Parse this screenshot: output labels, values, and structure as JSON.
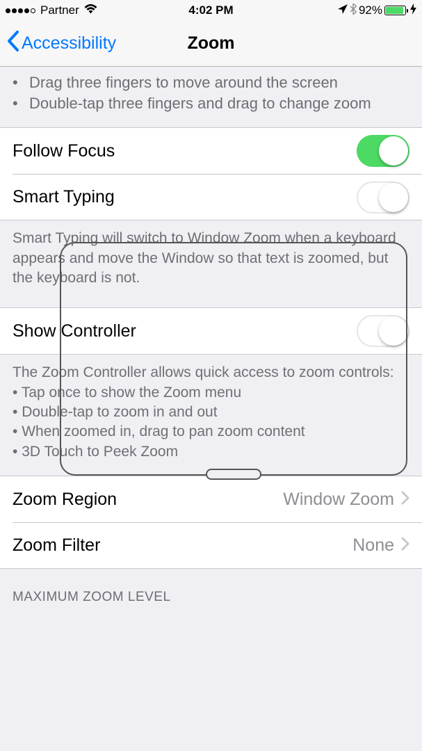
{
  "status": {
    "carrier": "Partner",
    "time": "4:02 PM",
    "battery_pct": "92%"
  },
  "nav": {
    "back_label": "Accessibility",
    "title": "Zoom"
  },
  "intro_help": {
    "line1": "Drag three fingers to move around the screen",
    "line2": "Double-tap three fingers and drag to change zoom"
  },
  "followFocus": {
    "label": "Follow Focus"
  },
  "smartTyping": {
    "label": "Smart Typing",
    "footer": "Smart Typing will switch to Window Zoom when a keyboard appears and move the Window so that text is zoomed, but the keyboard is not."
  },
  "showController": {
    "label": "Show Controller",
    "footer_intro": "The Zoom Controller allows quick access to zoom controls:",
    "footer_b1": "Tap once to show the Zoom menu",
    "footer_b2": "Double-tap to zoom in and out",
    "footer_b3": "When zoomed in, drag to pan zoom content",
    "footer_b4": "3D Touch to Peek Zoom"
  },
  "zoomRegion": {
    "label": "Zoom Region",
    "value": "Window Zoom"
  },
  "zoomFilter": {
    "label": "Zoom Filter",
    "value": "None"
  },
  "maxZoom": {
    "header": "MAXIMUM ZOOM LEVEL"
  }
}
